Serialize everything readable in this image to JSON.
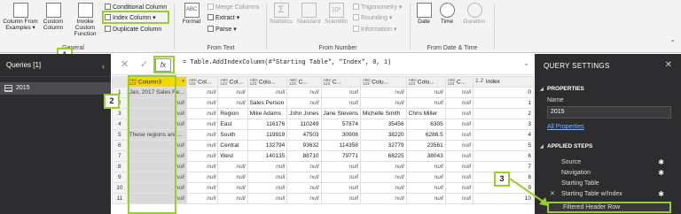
{
  "ribbon": {
    "column_from_examples": "Column From Examples ▾",
    "custom_column": "Custom Column",
    "invoke_custom_function": "Invoke Custom Function",
    "conditional_column": "Conditional Column",
    "index_column": "Index Column ▾",
    "duplicate_column": "Duplicate Column",
    "general_label": "General",
    "format": "Format",
    "merge_columns": "Merge Columns",
    "extract": "Extract ▾",
    "parse": "Parse ▾",
    "from_text_label": "From Text",
    "statistics": "Statistics",
    "standard": "Standard",
    "scientific": "Scientific",
    "trigonometry": "Trigonometry ▾",
    "rounding": "Rounding ▾",
    "information": "Information ▾",
    "from_number_label": "From Number",
    "date": "Date",
    "time": "Time",
    "duration": "Duration",
    "from_date_time_label": "From Date & Time",
    "abc_glyph": "ABC",
    "sigma_glyph": "Σ",
    "power_glyph": "10²",
    "chevron_up": "⌃"
  },
  "callouts": [
    "1",
    "2",
    "3"
  ],
  "queries": {
    "title": "Queries [1]",
    "collapse": "‹",
    "items": [
      "2015"
    ]
  },
  "formula_bar": {
    "cancel": "✕",
    "commit": "✓",
    "fx": "fx",
    "formula": "= Table.AddIndexColumn(#\"Starting Table\", \"Index\", 0, 1)",
    "expand": "⌄"
  },
  "grid": {
    "type_abc": "ABC",
    "type_123": "123",
    "type_dec": "1.2",
    "dropdown": "▾",
    "headers": [
      "Column3",
      "Col...",
      "Col...",
      "Colu...",
      "C...",
      "C...",
      "Colu...",
      "Colu...",
      "C...",
      "Index"
    ],
    "rows": [
      [
        "1",
        "Jan, 2017 Sales Re...",
        "null",
        "null",
        "null",
        "null",
        "null",
        "null",
        "null",
        "null",
        "0"
      ],
      [
        "2",
        "null",
        "null",
        "null",
        "Sales Person",
        "null",
        "null",
        "null",
        "null",
        "null",
        "1"
      ],
      [
        "3",
        "null",
        "null",
        "Region",
        "Mike Adams",
        "John Jones",
        "Jane Stevens",
        "Michelle Smith",
        "Chris Miller",
        "null",
        "2"
      ],
      [
        "4",
        "null",
        "null",
        "East",
        "116176",
        "110249",
        "57874",
        "35456",
        "6305",
        "null",
        "3"
      ],
      [
        "5",
        "These regions are ...",
        "null",
        "South",
        "119919",
        "47503",
        "30906",
        "38220",
        "6286.5",
        "null",
        "4"
      ],
      [
        "6",
        "null",
        "null",
        "Central",
        "132794",
        "93632",
        "114358",
        "32779",
        "23561",
        "null",
        "5"
      ],
      [
        "7",
        "null",
        "null",
        "West",
        "140135",
        "88710",
        "79771",
        "68225",
        "38043",
        "null",
        "6"
      ],
      [
        "8",
        "null",
        "null",
        "null",
        "null",
        "null",
        "null",
        "null",
        "null",
        "null",
        "7"
      ],
      [
        "9",
        "null",
        "null",
        "null",
        "null",
        "null",
        "null",
        "null",
        "null",
        "null",
        "8"
      ],
      [
        "10",
        "null",
        "null",
        "null",
        "null",
        "null",
        "null",
        "null",
        "null",
        "null",
        "9"
      ],
      [
        "11",
        "null",
        "null",
        "null",
        "null",
        "null",
        "null",
        "null",
        "null",
        "null",
        "10"
      ]
    ]
  },
  "query_settings": {
    "title": "QUERY SETTINGS",
    "close": "✕",
    "properties_label": "PROPERTIES",
    "name_label": "Name",
    "name_value": "2015",
    "all_properties": "All Properties",
    "applied_steps_label": "APPLIED STEPS",
    "steps": [
      "Source",
      "Navigation",
      "Starting Table",
      "Starting Table w/Index",
      "Filtered Header Row"
    ],
    "gear": "✱",
    "step_x": "✕",
    "section_marker": "◢"
  },
  "colors": {
    "highlight": "#9acd32",
    "selected_column": "#f5d800",
    "dark_pane": "#2d2d30"
  }
}
